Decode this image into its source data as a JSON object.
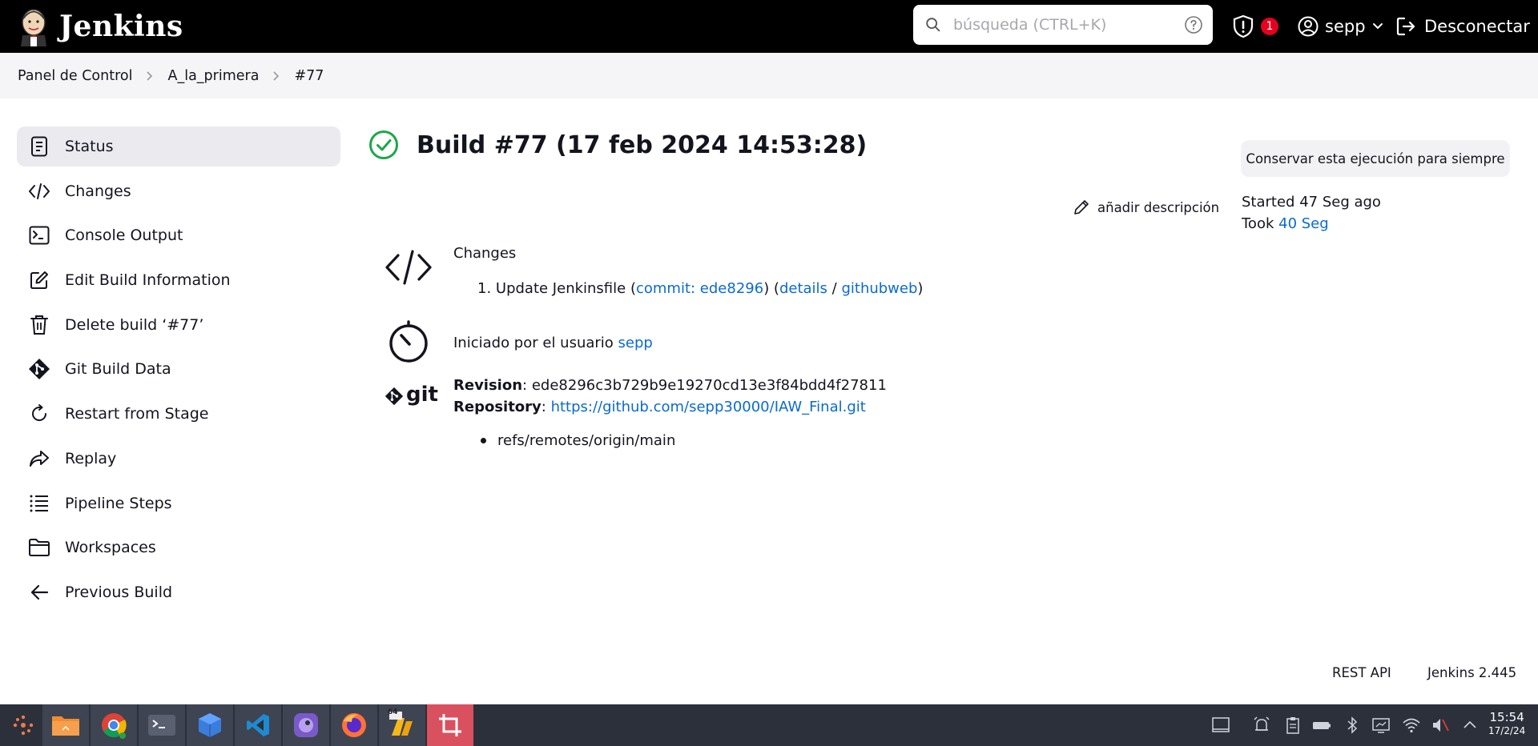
{
  "header": {
    "app_name": "Jenkins",
    "search_placeholder": "búsqueda (CTRL+K)",
    "alert_count": "1",
    "user": "sepp",
    "logout_label": "Desconectar"
  },
  "breadcrumb": [
    "Panel de Control",
    "A_la_primera",
    "#77"
  ],
  "sidebar": {
    "items": [
      {
        "label": "Status",
        "icon": "document-icon"
      },
      {
        "label": "Changes",
        "icon": "code-icon"
      },
      {
        "label": "Console Output",
        "icon": "terminal-icon"
      },
      {
        "label": "Edit Build Information",
        "icon": "edit-icon"
      },
      {
        "label": "Delete build ‘#77’",
        "icon": "trash-icon"
      },
      {
        "label": "Git Build Data",
        "icon": "git-icon"
      },
      {
        "label": "Restart from Stage",
        "icon": "restart-icon"
      },
      {
        "label": "Replay",
        "icon": "replay-icon"
      },
      {
        "label": "Pipeline Steps",
        "icon": "steps-icon"
      },
      {
        "label": "Workspaces",
        "icon": "folder-icon"
      },
      {
        "label": "Previous Build",
        "icon": "arrow-left-icon"
      }
    ]
  },
  "build": {
    "title": "Build #77 (17 feb 2024 14:53:28)",
    "keep_button": "Conservar esta ejecución para siempre",
    "add_description": "añadir descripción",
    "started": "Started 47 Seg ago",
    "took_label": "Took",
    "took_value": "40 Seg"
  },
  "changes": {
    "heading": "Changes",
    "item_prefix": "1. Update Jenkinsfile (",
    "commit_link": "commit: ede8296",
    "mid": ") (",
    "details_link": "details",
    "slash": " / ",
    "githubweb_link": "githubweb",
    "suffix": ")"
  },
  "cause": {
    "text": "Iniciado por el usuario",
    "user_link": "sepp"
  },
  "git": {
    "logo_text": "git",
    "revision_label": "Revision",
    "revision": "ede8296c3b729b9e19270cd13e3f84bdd4f27811",
    "repository_label": "Repository",
    "repository": "https://github.com/sepp30000/IAW_Final.git",
    "ref": "refs/remotes/origin/main"
  },
  "footer": {
    "rest_api": "REST API",
    "version": "Jenkins 2.445"
  },
  "taskbar": {
    "time": "15:54",
    "date": "17/2/24",
    "app_badge": "64"
  },
  "colors": {
    "header_bg": "#000000",
    "link": "#0b6bcb",
    "success": "#1ea64b",
    "badge": "#e6001f",
    "taskbar_bg": "#2b303b"
  }
}
